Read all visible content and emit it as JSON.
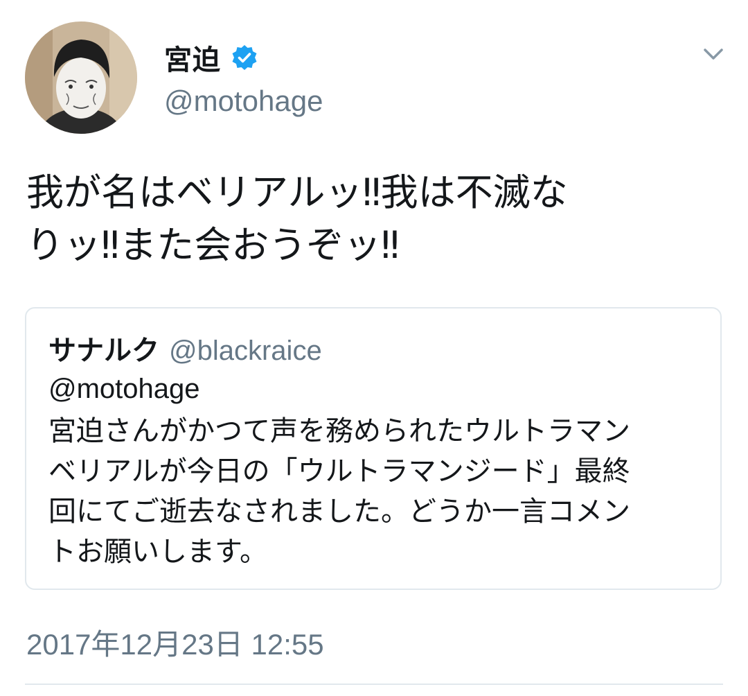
{
  "tweet": {
    "author": {
      "display_name": "宮迫",
      "handle": "@motohage",
      "verified": true
    },
    "text": "我が名はベリアルッ‼我は不滅な\nりッ‼また会おうぞッ‼",
    "quoted_tweet": {
      "display_name": "サナルク",
      "handle": "@blackraice",
      "mention": "@motohage",
      "text": "宮迫さんがかつて声を務められたウルトラマン\nベリアルが今日の「ウルトラマンジード」最終\n回にてご逝去なされました。どうか一言コメン\nトお願いします。"
    },
    "timestamp": "2017年12月23日 12:55"
  },
  "colors": {
    "text_primary": "#14171a",
    "text_secondary": "#657786",
    "verified_blue": "#1da1f2",
    "border": "#e1e8ed"
  },
  "icons": {
    "verified": "verified-badge-icon",
    "menu": "chevron-down-icon"
  }
}
